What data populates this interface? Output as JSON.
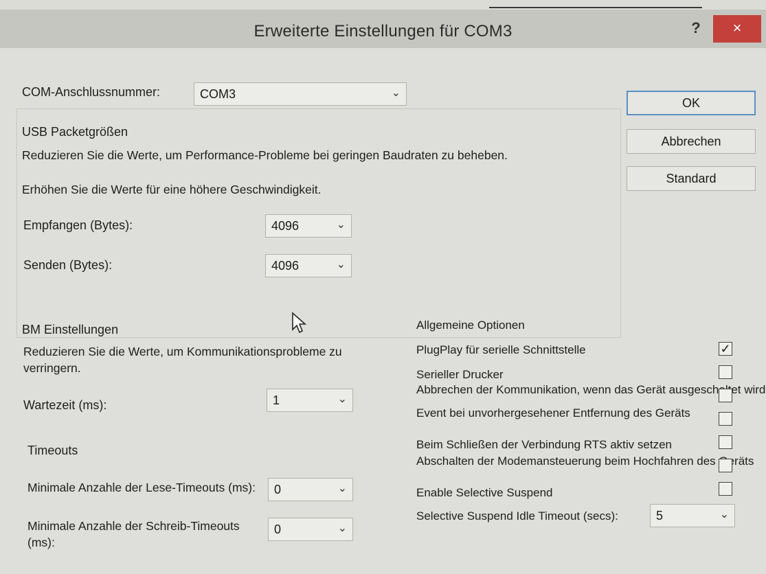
{
  "window": {
    "title": "Erweiterte Einstellungen für COM3",
    "help_label": "?",
    "close_label": "×"
  },
  "port": {
    "label": "COM-Anschlussnummer:",
    "value": "COM3"
  },
  "buttons": {
    "ok": "OK",
    "cancel": "Abbrechen",
    "default": "Standard"
  },
  "usb": {
    "heading": "USB Packetgrößen",
    "desc_reduce": "Reduzieren Sie die Werte, um Performance-Probleme bei geringen Baudraten zu beheben.",
    "desc_increase": "Erhöhen Sie die Werte für eine höhere Geschwindigkeit.",
    "receive_label": "Empfangen (Bytes):",
    "receive_value": "4096",
    "send_label": "Senden (Bytes):",
    "send_value": "4096"
  },
  "bm": {
    "heading": "BM Einstellungen",
    "desc": "Reduzieren Sie die Werte, um Kommunikationsprobleme zu verringern.",
    "latency_label": "Wartezeit (ms):",
    "latency_value": "1"
  },
  "timeouts": {
    "heading": "Timeouts",
    "read_label": "Minimale Anzahle der Lese-Timeouts (ms):",
    "read_value": "0",
    "write_label": "Minimale Anzahle der Schreib-Timeouts (ms):",
    "write_value": "0"
  },
  "options": {
    "heading": "Allgemeine Optionen",
    "items": [
      {
        "label": "PlugPlay für serielle Schnittstelle",
        "checked": true
      },
      {
        "label": "Serieller Drucker",
        "checked": false
      },
      {
        "label": "Abbrechen der Kommunikation, wenn das Gerät ausgeschaltet wird",
        "checked": false
      },
      {
        "label": "Event bei unvorhergesehener Entfernung des Geräts",
        "checked": false
      },
      {
        "label": "Beim Schließen der Verbindung RTS aktiv setzen",
        "checked": false
      },
      {
        "label": "Abschalten der Modemansteuerung beim Hochfahren des Geräts",
        "checked": false
      },
      {
        "label": "Enable Selective Suspend",
        "checked": false
      }
    ],
    "idle_label": "Selective Suspend Idle Timeout (secs):",
    "idle_value": "5"
  },
  "icons": {
    "dropdown": "chevron-down-icon",
    "check": "checkmark-icon",
    "pointer": "mouse-pointer-icon"
  }
}
